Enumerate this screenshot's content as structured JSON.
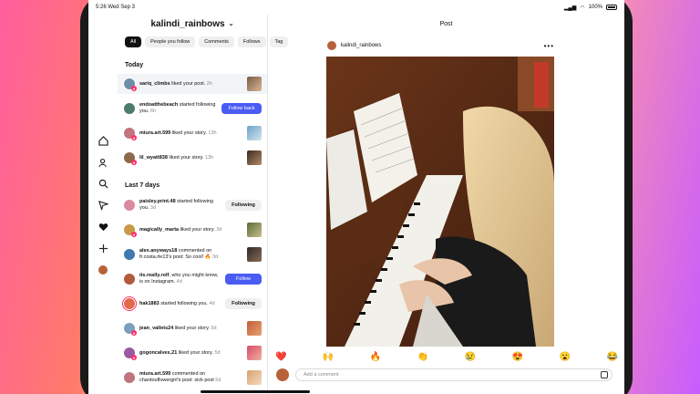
{
  "status": {
    "time": "5:26",
    "date": "Wed Sep 3",
    "battery": "100%"
  },
  "account": {
    "name": "kalindi_rainbows"
  },
  "filters": [
    "All",
    "People you follow",
    "Comments",
    "Follows",
    "Tag"
  ],
  "sections": {
    "today": "Today",
    "last7": "Last 7 days"
  },
  "notifications": [
    {
      "user": "sariq_climbs",
      "text": " liked your post.",
      "time": " 2h"
    },
    {
      "user": "endoatthebeach",
      "text": " started following you.",
      "time": " 6h",
      "button": "Follow back"
    },
    {
      "user": "miura.art.599",
      "text": " liked your story.",
      "time": " 13h"
    },
    {
      "user": "lil_wyatt838",
      "text": " liked your story.",
      "time": " 13h"
    },
    {
      "user": "paisley.print.48",
      "text": " started following you.",
      "time": " 3d",
      "button": "Following"
    },
    {
      "user": "magically_marta",
      "text": " liked your story.",
      "time": " 3d"
    },
    {
      "user": "alex.anyways18",
      "text": " commented on fr.costa.rle13's post: So cool! 🔥",
      "time": " 3d"
    },
    {
      "user": "its.really.rolf",
      "text": ", who you might know, is on Instagram.",
      "time": " 4d",
      "button": "Follow"
    },
    {
      "user": "hak1883",
      "text": " started following you.",
      "time": " 4d",
      "button": "Following"
    },
    {
      "user": "jean_vallets24",
      "text": " liked your story.",
      "time": " 5d"
    },
    {
      "user": "gogoncalves.21",
      "text": " liked your story.",
      "time": " 5d"
    },
    {
      "user": "miura.art.599",
      "text": " commented on chantouflowergirl's post: sick post",
      "time": " 5d"
    }
  ],
  "post": {
    "title": "Post",
    "username": "kalindi_rainbows",
    "more": "•••",
    "reactions": [
      "❤️",
      "🙌",
      "🔥",
      "👏",
      "😢",
      "😍",
      "😮",
      "😂"
    ],
    "comment_placeholder": "Add a comment"
  },
  "rail_icons": [
    "home-icon",
    "people-icon",
    "search-icon",
    "send-icon",
    "heart-icon",
    "plus-icon",
    "profile-avatar"
  ],
  "colors": {
    "accent": "#4a5cf2",
    "badge": "#ff2d6a"
  }
}
